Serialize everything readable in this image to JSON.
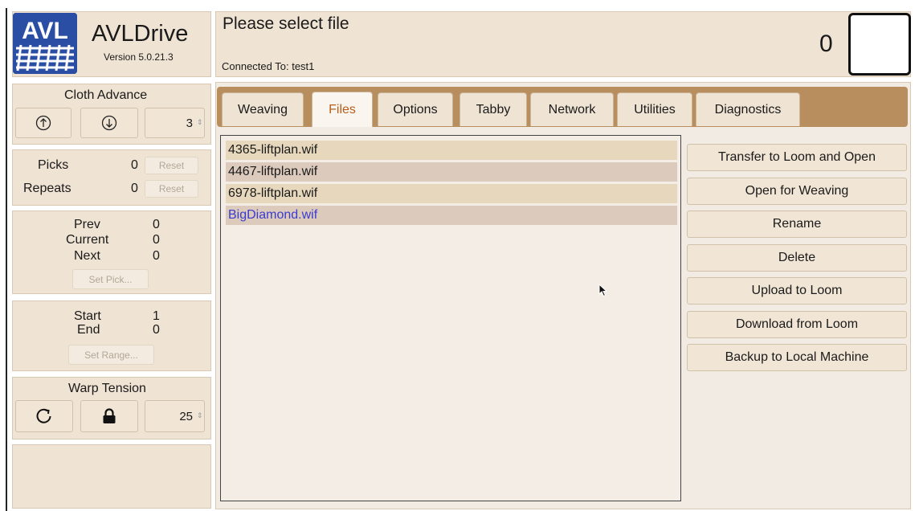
{
  "app": {
    "logo_text": "AVL",
    "name": "AVLDrive",
    "version": "Version 5.0.21.3"
  },
  "header": {
    "status": "Please select file",
    "connection": "Connected To: test1",
    "counter": "0"
  },
  "cloth_advance": {
    "title": "Cloth Advance",
    "up_icon": "arrow-up-circle-icon",
    "down_icon": "arrow-down-circle-icon",
    "value": "3"
  },
  "picks": {
    "picks_label": "Picks",
    "picks_value": "0",
    "repeats_label": "Repeats",
    "repeats_value": "0",
    "reset_label": "Reset"
  },
  "position": {
    "prev_label": "Prev",
    "prev_value": "0",
    "current_label": "Current",
    "current_value": "0",
    "next_label": "Next",
    "next_value": "0",
    "set_pick_label": "Set Pick..."
  },
  "range": {
    "start_label": "Start",
    "start_value": "1",
    "end_label": "End",
    "end_value": "0",
    "set_range_label": "Set Range..."
  },
  "warp_tension": {
    "title": "Warp Tension",
    "cycle_icon": "refresh-icon",
    "lock_icon": "lock-icon",
    "value": "25"
  },
  "tabs": [
    "Weaving",
    "Files",
    "Options",
    "Tabby",
    "Network",
    "Utilities",
    "Diagnostics"
  ],
  "active_tab": "Files",
  "files": [
    "4365-liftplan.wif",
    "4467-liftplan.wif",
    "6978-liftplan.wif",
    "BigDiamond.wif"
  ],
  "file_row_colors": [
    "#e7d8bd",
    "#dccbbd",
    "#e7d8bd",
    "#dccbbd"
  ],
  "selected_file_color": "#3a3ad0",
  "actions": [
    "Transfer to Loom and Open",
    "Open for Weaving",
    "Rename",
    "Delete",
    "Upload to Loom",
    "Download from Loom",
    "Backup to Local Machine"
  ],
  "colors": {
    "accent_tab_text": "#b45f1d",
    "tabbar_bg": "#b98e5e",
    "panel_bg": "#efe3d3",
    "logo_bg": "#2a4ea3"
  }
}
